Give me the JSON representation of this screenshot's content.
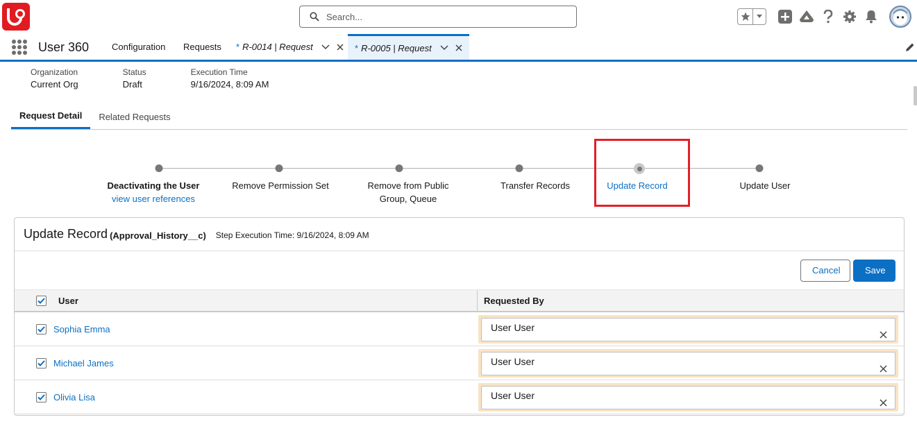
{
  "header": {
    "search_placeholder": "Search..."
  },
  "nav": {
    "app_name": "User 360",
    "items": [
      {
        "label": "Configuration"
      },
      {
        "label": "Requests"
      }
    ],
    "tabs": [
      {
        "modified": "*",
        "label": "R-0014 | Request",
        "active": false
      },
      {
        "modified": "*",
        "label": "R-0005 | Request",
        "active": true
      }
    ]
  },
  "highlights": [
    {
      "label": "Organization",
      "value": "Current Org"
    },
    {
      "label": "Status",
      "value": "Draft"
    },
    {
      "label": "Execution Time",
      "value": "9/16/2024, 8:09 AM"
    }
  ],
  "tabs": [
    {
      "label": "Request Detail",
      "active": true
    },
    {
      "label": "Related Requests",
      "active": false
    }
  ],
  "path": {
    "steps": [
      {
        "label": "Deactivating the User",
        "sublabel": "view user references"
      },
      {
        "label": "Remove Permission Set"
      },
      {
        "label": "Remove from Public",
        "label2": "Group, Queue"
      },
      {
        "label": "Transfer Records"
      },
      {
        "label": "Update Record",
        "current": true
      },
      {
        "label": "Update User"
      }
    ]
  },
  "card": {
    "title": "Update Record",
    "object": "(Approval_History__c)",
    "exec_time": "Step Execution Time: 9/16/2024, 8:09 AM",
    "cancel_label": "Cancel",
    "save_label": "Save",
    "columns": [
      "User",
      "Requested By"
    ],
    "rows": [
      {
        "user": "Sophia Emma",
        "requested_by": "User User",
        "checked": true
      },
      {
        "user": "Michael James",
        "requested_by": "User User",
        "checked": true
      },
      {
        "user": "Olivia Lisa",
        "requested_by": "User User",
        "checked": true
      }
    ]
  },
  "colors": {
    "brand_red": "#e11b22",
    "accent_blue": "#0b6fc4",
    "highlight_box": "#e0202a",
    "lookup_highlight": "#f9e3c4"
  }
}
